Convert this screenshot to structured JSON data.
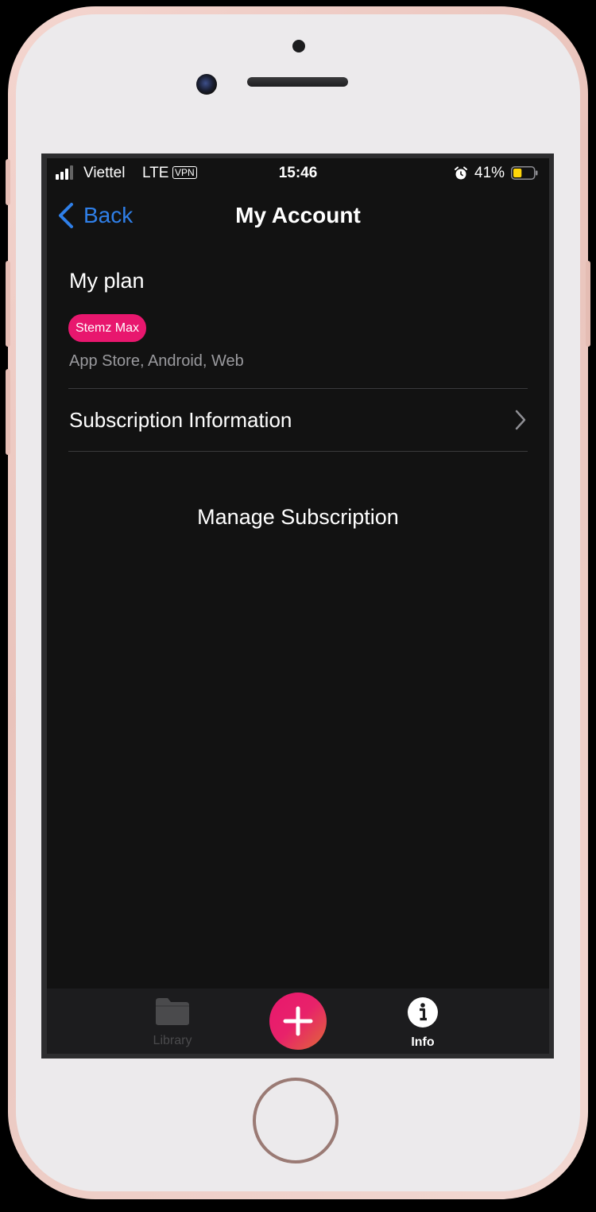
{
  "status_bar": {
    "carrier": "Viettel",
    "network": "LTE",
    "vpn": "VPN",
    "time": "15:46",
    "battery_percent": "41%",
    "battery_level": 0.41,
    "battery_color": "#ffd60a",
    "alarm_icon": "alarm-clock-icon"
  },
  "nav": {
    "back_label": "Back",
    "back_icon": "chevron-left-icon",
    "title": "My Account",
    "accent": "#2f7fe8"
  },
  "plan": {
    "heading": "My plan",
    "badge": "Stemz Max",
    "badge_color": "#e8176e",
    "platforms": "App Store, Android, Web"
  },
  "subscription_info": {
    "label": "Subscription Information",
    "icon": "chevron-right-icon"
  },
  "manage": {
    "label": "Manage Subscription"
  },
  "tab_bar": {
    "library": {
      "label": "Library",
      "icon": "folder-icon"
    },
    "add": {
      "icon": "plus-icon"
    },
    "info": {
      "label": "Info",
      "icon": "info-icon"
    }
  }
}
